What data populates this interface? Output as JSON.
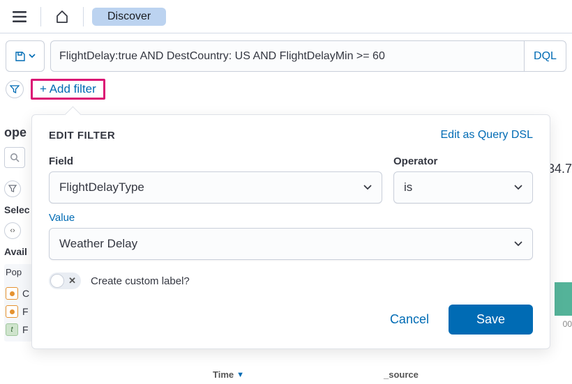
{
  "topbar": {
    "discover_label": "Discover"
  },
  "querybar": {
    "query_text": "FlightDelay:true AND DestCountry: US AND FlightDelayMin >= 60",
    "dql_label": "DQL"
  },
  "filters": {
    "add_filter_label": "+ Add filter"
  },
  "sidebar": {
    "index_label": "ope",
    "selected_label": "Selec",
    "available_label": "Avail",
    "popular_label": "Pop",
    "items": [
      {
        "label_fragment": "C"
      },
      {
        "label_fragment": "F"
      },
      {
        "label_fragment": "F"
      }
    ]
  },
  "right": {
    "peek_num": "34.7",
    "mini_num": "00"
  },
  "columns": {
    "time": "Time",
    "source": "_source"
  },
  "popover": {
    "title": "EDIT FILTER",
    "edit_dsl": "Edit as Query DSL",
    "field_label": "Field",
    "field_value": "FlightDelayType",
    "operator_label": "Operator",
    "operator_value": "is",
    "value_label": "Value",
    "value_value": "Weather Delay",
    "custom_label_text": "Create custom label?",
    "cancel": "Cancel",
    "save": "Save"
  }
}
